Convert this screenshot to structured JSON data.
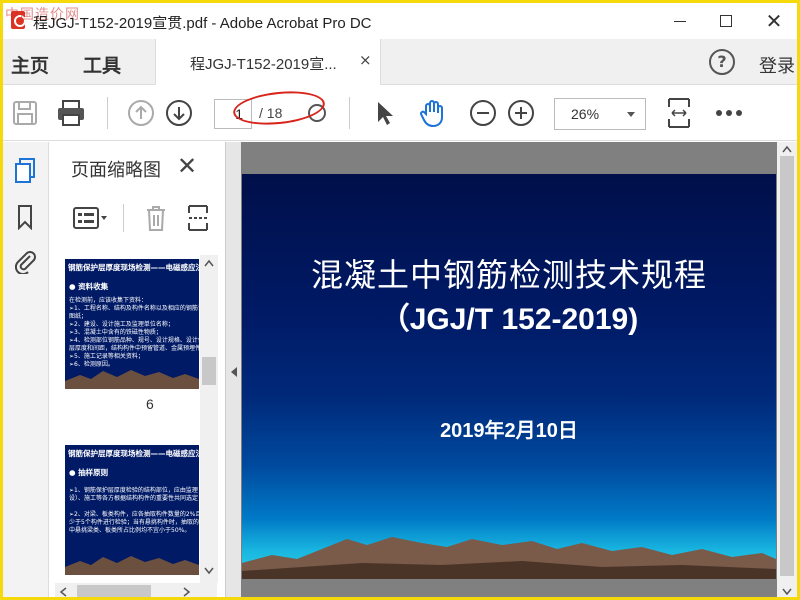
{
  "window": {
    "title": "程JGJ-T152-2019宣贯.pdf - Adobe Acrobat Pro DC",
    "watermark": "中国造价网",
    "close_glyph": "✕"
  },
  "menu": {
    "home": "主页",
    "tools": "工具",
    "doc_tab_label": "程JGJ-T152-2019宣...",
    "doc_tab_close": "×",
    "help": "?",
    "login": "登录"
  },
  "toolbar": {
    "current_page": "1",
    "total_pages": "/ 18",
    "zoom": "26%",
    "icons": [
      "save-icon",
      "print-icon",
      "page-up-icon",
      "page-down-icon",
      "select-arrow-icon",
      "hand-tool-icon",
      "zoom-out-icon",
      "zoom-in-icon",
      "fit-page-icon",
      "more-icon"
    ],
    "annotation_color": "#d8241a"
  },
  "sidebar": {
    "panel_title": "页面缩略图",
    "close_glyph": "✕",
    "rail_icons": [
      "page-thumbnails-icon",
      "bookmark-icon",
      "attachment-icon"
    ],
    "thumbnails": [
      {
        "header": "钢筋保护层厚度现场检测——电磁感应法",
        "title": "● 资料收集",
        "lines": [
          "在检测前，应该收集下资料：",
          "➢1、工程名称、结构及构件名称以及相应的钢筋设计",
          "图纸；",
          "➢2、建设、设计施工及监理单位名称；",
          "➢3、混凝土中含有的铁磁性物质；",
          "➢4、检测部位钢筋品种、规号、设计规格、设计保护",
          "层厚度和间距，结构构件中预留管道、金属预埋件等",
          "➢5、施工记录等相关资料；",
          "➢6、检测原因。"
        ],
        "page_number": "6"
      },
      {
        "header": "钢筋保护层厚度现场检测——电磁感应法",
        "title": "● 抽样原则",
        "lines": [
          "➢1、钢筋保护层厚度检验的结构部位，应由监理（建",
          "设）、施工等各方根据结构构件的重要性共同选定；",
          "",
          "➢2、对梁、板类构件，应各抽取构件数量的2%且不",
          "少于5个构件进行检验；当有悬挑构件时，抽取的构",
          "中悬挑梁类、板类所占比例均不宜小于50%。"
        ]
      }
    ]
  },
  "slide": {
    "title": "混凝土中钢筋检测技术规程",
    "subtitle": "（JGJ/T 152-2019)",
    "date": "2019年2月10日",
    "colors": {
      "top": "#000f4a",
      "bottom": "#30d0e8",
      "mountain": "#7a5a48"
    }
  }
}
